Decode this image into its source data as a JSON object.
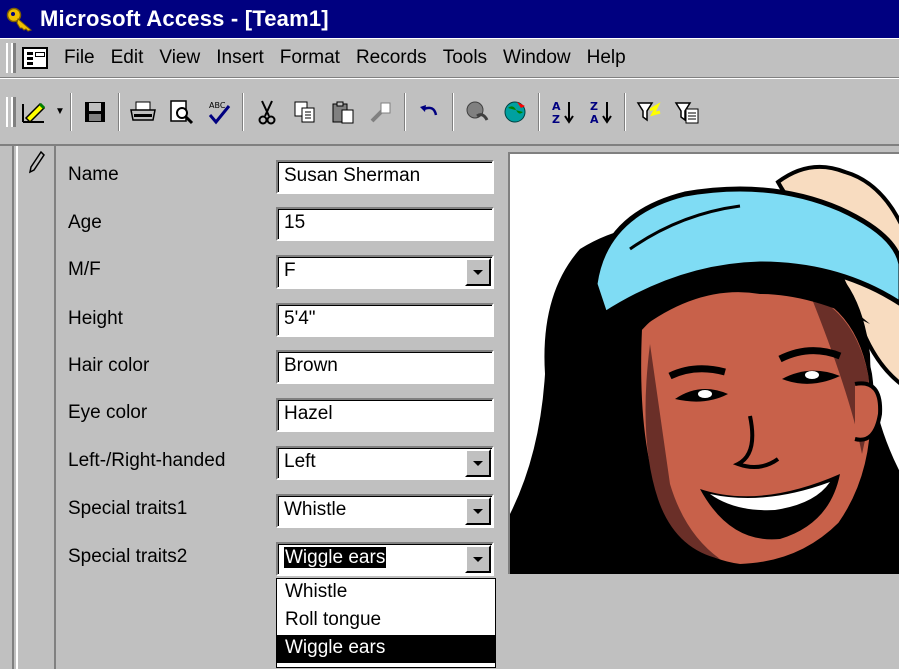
{
  "window": {
    "title": "Microsoft Access - [Team1]"
  },
  "menu": [
    "File",
    "Edit",
    "View",
    "Insert",
    "Format",
    "Records",
    "Tools",
    "Window",
    "Help"
  ],
  "toolbar": {
    "buttons": [
      "design-view-icon",
      "save-icon",
      "print-icon",
      "print-preview-icon",
      "spelling-icon",
      "cut-icon",
      "copy-icon",
      "paste-icon",
      "format-painter-icon",
      "undo-icon",
      "insert-hyperlink-icon",
      "web-toolbar-icon",
      "sort-ascending-icon",
      "sort-descending-icon",
      "filter-by-selection-icon",
      "filter-by-form-icon"
    ]
  },
  "form": {
    "fields": [
      {
        "label": "Name",
        "value": "Susan Sherman",
        "type": "text"
      },
      {
        "label": "Age",
        "value": "15",
        "type": "text"
      },
      {
        "label": "M/F",
        "value": "F",
        "type": "combo"
      },
      {
        "label": "Height",
        "value": "5'4\"",
        "type": "text"
      },
      {
        "label": "Hair color",
        "value": "Brown",
        "type": "text"
      },
      {
        "label": "Eye color",
        "value": "Hazel",
        "type": "text"
      },
      {
        "label": "Left-/Right-handed",
        "value": "Left",
        "type": "combo"
      },
      {
        "label": "Special traits1",
        "value": "Whistle",
        "type": "combo"
      },
      {
        "label": "Special traits2",
        "value": "Wiggle ears",
        "type": "combo"
      }
    ],
    "dropdown_options": [
      "Whistle",
      "Roll tongue",
      "Wiggle ears"
    ],
    "dropdown_selected": "Wiggle ears"
  },
  "colors": {
    "title_bar": "#000080",
    "face": "#c0c0c0",
    "selection": "#000000"
  }
}
